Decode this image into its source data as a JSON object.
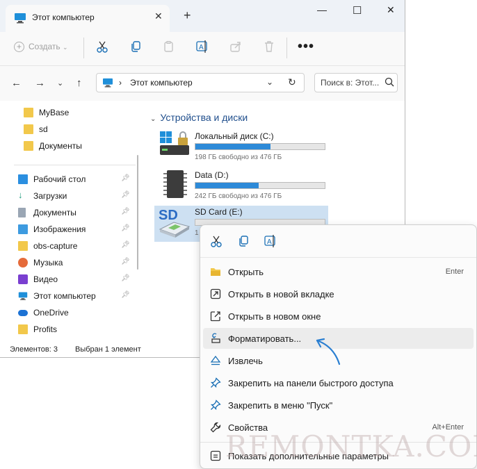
{
  "titlebar": {
    "tab_title": "Этот компьютер",
    "tab_icon": "computer-icon",
    "close_tab": "✕",
    "new_tab": "+",
    "minimize": "—",
    "maximize": "☐",
    "close": "✕"
  },
  "toolbar": {
    "create_label": "Создать",
    "more": "•••"
  },
  "address": {
    "path": "Этот компьютер",
    "search_placeholder": "Поиск в: Этот..."
  },
  "nav": {
    "quick": [
      {
        "label": "MyBase",
        "icon": "folder-icon"
      },
      {
        "label": "sd",
        "icon": "folder-icon"
      },
      {
        "label": "Документы",
        "icon": "folder-icon"
      }
    ],
    "pinned": [
      {
        "label": "Рабочий стол",
        "icon": "desktop-icon"
      },
      {
        "label": "Загрузки",
        "icon": "download-icon"
      },
      {
        "label": "Документы",
        "icon": "documents-icon"
      },
      {
        "label": "Изображения",
        "icon": "pictures-icon"
      },
      {
        "label": "obs-capture",
        "icon": "folder-icon"
      },
      {
        "label": "Музыка",
        "icon": "music-icon"
      },
      {
        "label": "Видео",
        "icon": "video-icon"
      },
      {
        "label": "Этот компьютер",
        "icon": "computer-icon"
      },
      {
        "label": "OneDrive",
        "icon": "cloud-icon"
      },
      {
        "label": "Profits",
        "icon": "folder-icon"
      }
    ]
  },
  "content": {
    "group_title": "Устройства и диски",
    "drives": [
      {
        "name": "Локальный диск (C:)",
        "free": "198 ГБ свободно из 476 ГБ",
        "used_fraction": 0.58,
        "icon": "windows-drive-icon"
      },
      {
        "name": "Data (D:)",
        "free": "242 ГБ свободно из 476 ГБ",
        "used_fraction": 0.49,
        "icon": "hdd-icon"
      },
      {
        "name": "SD Card (E:)",
        "free": "1",
        "used_fraction": 0.0,
        "icon": "sd-card-icon"
      }
    ]
  },
  "status": {
    "count": "Элементов: 3",
    "selected": "Выбран 1 элемент"
  },
  "context_menu": {
    "items": [
      {
        "label": "Открыть",
        "shortcut": "Enter",
        "icon": "folder-open-icon"
      },
      {
        "label": "Открыть в новой вкладке",
        "shortcut": "",
        "icon": "new-tab-icon"
      },
      {
        "label": "Открыть в новом окне",
        "shortcut": "",
        "icon": "new-window-icon"
      },
      {
        "label": "Форматировать...",
        "shortcut": "",
        "icon": "format-icon"
      },
      {
        "label": "Извлечь",
        "shortcut": "",
        "icon": "eject-icon"
      },
      {
        "label": "Закрепить на панели быстрого доступа",
        "shortcut": "",
        "icon": "pin-icon"
      },
      {
        "label": "Закрепить в меню \"Пуск\"",
        "shortcut": "",
        "icon": "pin-start-icon"
      },
      {
        "label": "Свойства",
        "shortcut": "Alt+Enter",
        "icon": "properties-icon"
      },
      {
        "label": "Показать дополнительные параметры",
        "shortcut": "",
        "icon": "more-options-icon"
      }
    ]
  },
  "watermark": "REMONTKA.COM",
  "colors": {
    "accent": "#2d8ad8",
    "selection": "#cde0f2",
    "hover": "#ececec"
  }
}
